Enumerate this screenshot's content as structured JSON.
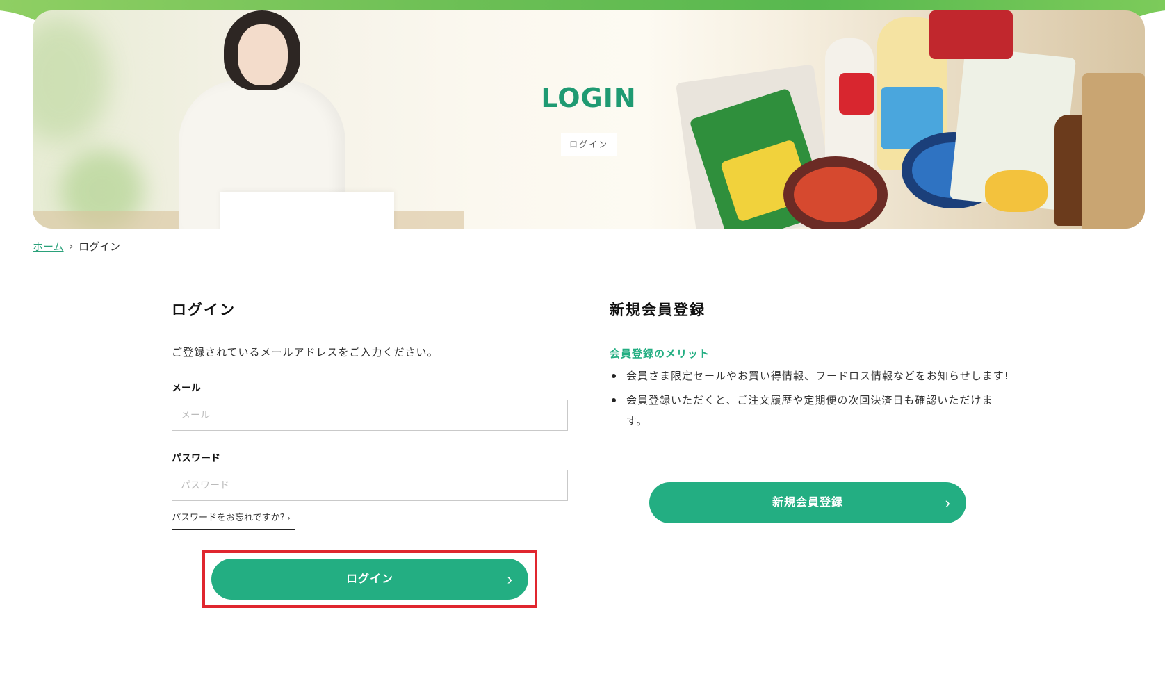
{
  "hero": {
    "title": "LOGIN",
    "subtitle": "ログイン"
  },
  "breadcrumb": {
    "home": "ホーム",
    "separator": "›",
    "current": "ログイン"
  },
  "login": {
    "heading": "ログイン",
    "description": "ご登録されているメールアドレスをご入力ください。",
    "email_label": "メール",
    "email_placeholder": "メール",
    "email_value": "",
    "password_label": "パスワード",
    "password_placeholder": "パスワード",
    "password_value": "",
    "forgot_link": "パスワードをお忘れですか?",
    "button_label": "ログイン"
  },
  "register": {
    "heading": "新規会員登録",
    "merit_title": "会員登録のメリット",
    "merits": [
      "会員さま限定セールやお買い得情報、フードロス情報などをお知らせします!",
      "会員登録いただくと、ご注文履歴や定期便の次回決済日も確認いただけます。"
    ],
    "button_label": "新規会員登録"
  },
  "colors": {
    "accent": "#23ae82",
    "title_green": "#1f9a72",
    "highlight": "#e0262f"
  },
  "icons": {
    "button_arrow": "chevron-right-icon",
    "breadcrumb_separator": "chevron-right-icon"
  }
}
